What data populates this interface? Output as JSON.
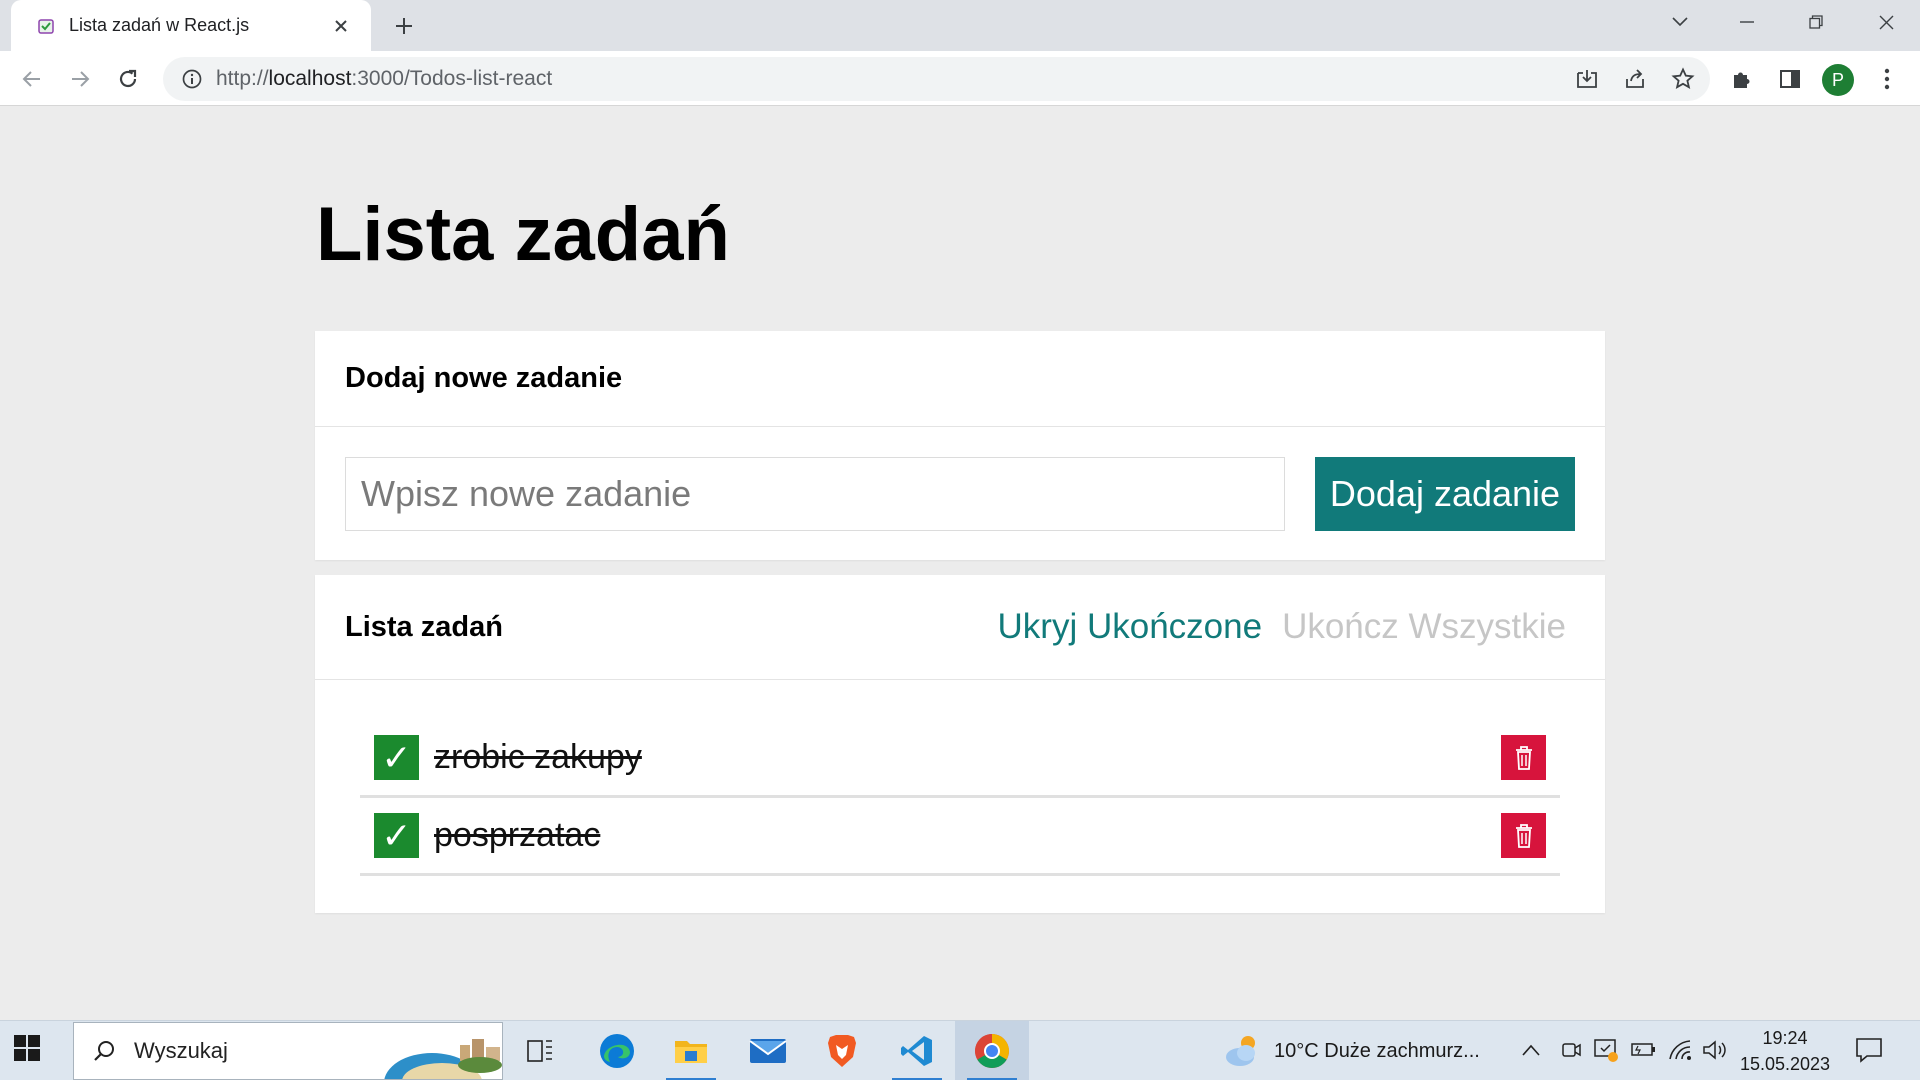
{
  "browser": {
    "tab_title": "Lista zadań w React.js",
    "new_tab_symbol": "+",
    "close_symbol": "✕",
    "url_prefix": "http://",
    "url_host": "localhost",
    "url_rest": ":3000/Todos-list-react",
    "profile_initial": "P"
  },
  "page": {
    "title": "Lista zadań",
    "add_section": {
      "heading": "Dodaj nowe zadanie",
      "input_placeholder": "Wpisz nowe zadanie",
      "input_value": "",
      "button_label": "Dodaj zadanie"
    },
    "list_section": {
      "heading": "Lista zadań",
      "hide_done_label": "Ukryj Ukończone",
      "complete_all_label": "Ukończ Wszystkie",
      "tasks": [
        {
          "text": "zrobic zakupy",
          "done": true,
          "check_symbol": "✓"
        },
        {
          "text": "posprzatac",
          "done": true,
          "check_symbol": "✓"
        }
      ]
    }
  },
  "taskbar": {
    "search_label": "Wyszukaj",
    "weather": "10°C  Duże zachmurz...",
    "time": "19:24",
    "date": "15.05.2023"
  },
  "colors": {
    "accent": "#117a7a",
    "done": "#1b8a2e",
    "delete": "#d7143c",
    "muted": "#c6c6c6"
  }
}
